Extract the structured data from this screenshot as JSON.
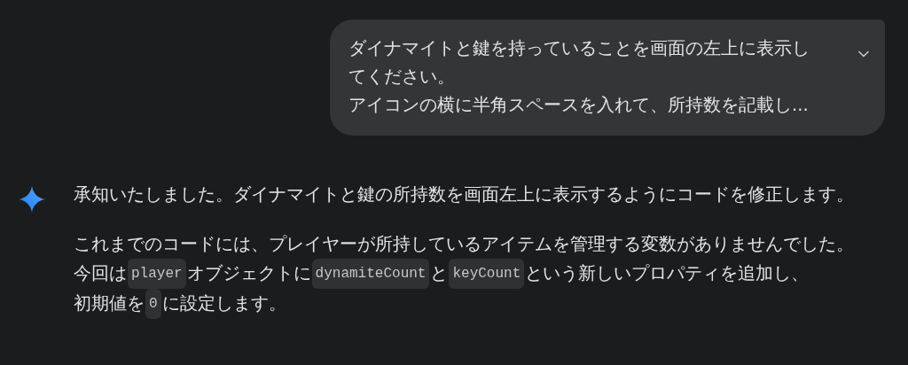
{
  "user_message": {
    "lines": [
      "ダイナマイトと鍵を持っていることを画面の左上に表示し",
      "てください。",
      "アイコンの横に半角スペースを入れて、所持数を記載し..."
    ],
    "expanded": false
  },
  "response": {
    "paragraphs": [
      {
        "lines": [
          [
            {
              "kind": "text",
              "text": "承知いたしました。ダイナマイトと鍵の所持数を画面左上に表示するようにコードを修正します。"
            }
          ]
        ]
      },
      {
        "lines": [
          [
            {
              "kind": "text",
              "text": "これまでのコードには、プレイヤーが所持しているアイテムを管理する変数がありませんでした。"
            }
          ],
          [
            {
              "kind": "text",
              "text": "今回は"
            },
            {
              "kind": "code",
              "text": "player"
            },
            {
              "kind": "text",
              "text": "オブジェクトに"
            },
            {
              "kind": "code",
              "text": "dynamiteCount"
            },
            {
              "kind": "text",
              "text": "と"
            },
            {
              "kind": "code",
              "text": "keyCount"
            },
            {
              "kind": "text",
              "text": "という新しいプロパティを追加し、"
            }
          ],
          [
            {
              "kind": "text",
              "text": "初期値を"
            },
            {
              "kind": "code",
              "text": "0"
            },
            {
              "kind": "text",
              "text": "に設定します。"
            }
          ]
        ]
      }
    ]
  }
}
